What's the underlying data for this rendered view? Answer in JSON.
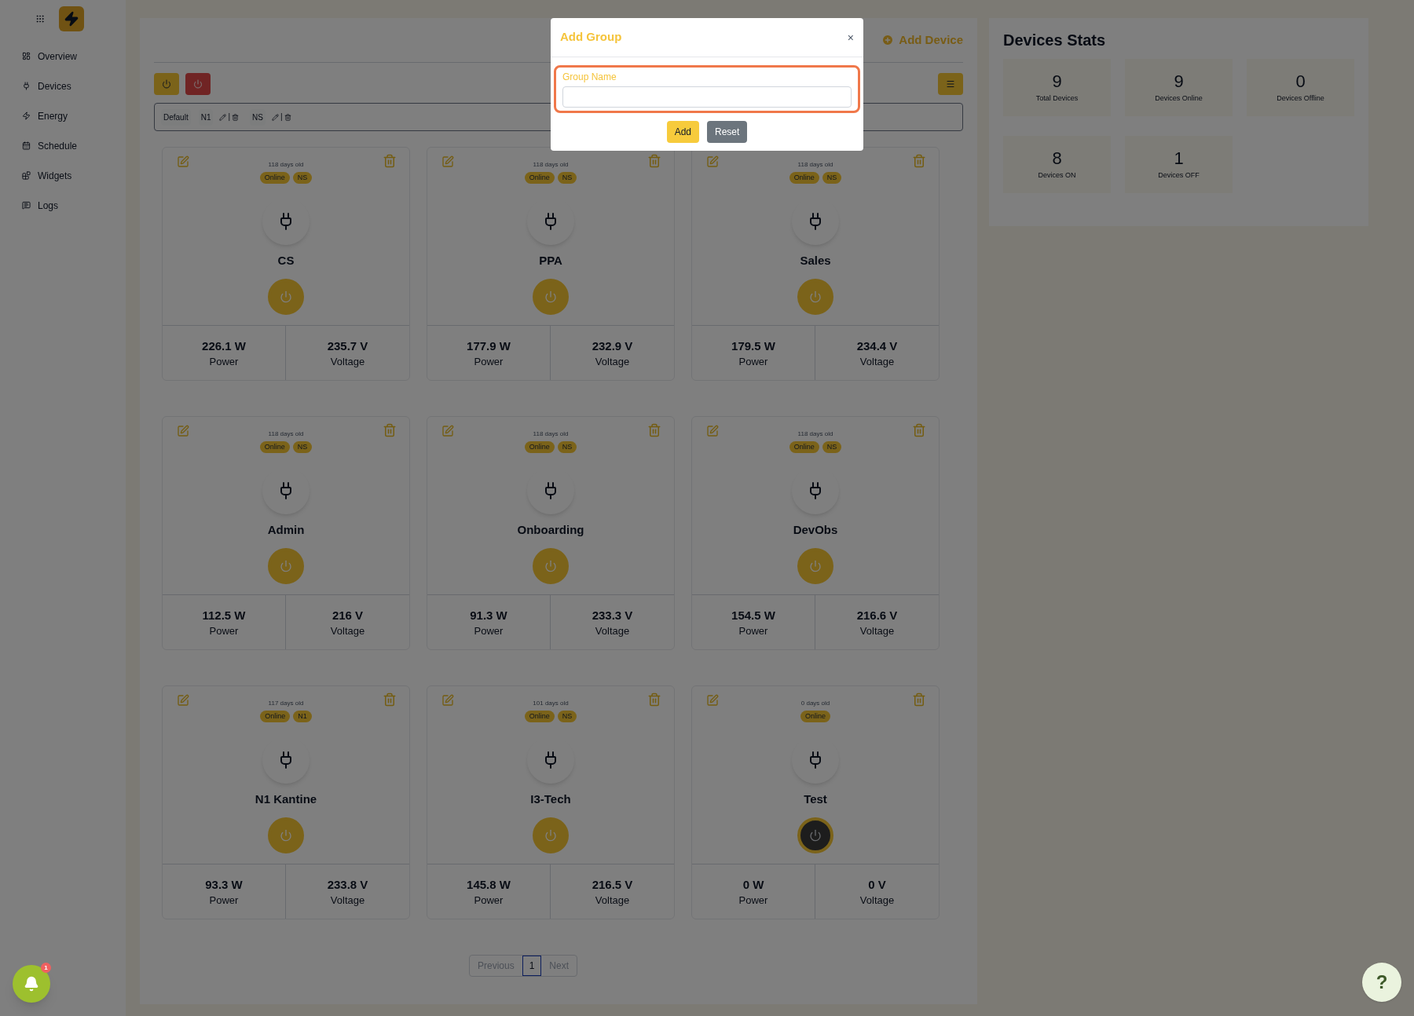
{
  "sidebar": {
    "items": [
      {
        "label": "Overview"
      },
      {
        "label": "Devices"
      },
      {
        "label": "Energy"
      },
      {
        "label": "Schedule"
      },
      {
        "label": "Widgets"
      },
      {
        "label": "Logs"
      }
    ]
  },
  "header": {
    "add_device": "Add Device"
  },
  "groups": [
    {
      "label": "Default",
      "editable": false
    },
    {
      "label": "N1",
      "editable": true,
      "separator": "|"
    },
    {
      "label": "NS",
      "editable": true,
      "separator": "|"
    }
  ],
  "devices": [
    {
      "age": "118 days old",
      "tags": [
        "Online",
        "NS"
      ],
      "name": "CS",
      "on": true,
      "power": "226.1 W",
      "power_label": "Power",
      "voltage": "235.7 V",
      "voltage_label": "Voltage"
    },
    {
      "age": "118 days old",
      "tags": [
        "Online",
        "NS"
      ],
      "name": "PPA",
      "on": true,
      "power": "177.9 W",
      "power_label": "Power",
      "voltage": "232.9 V",
      "voltage_label": "Voltage"
    },
    {
      "age": "118 days old",
      "tags": [
        "Online",
        "NS"
      ],
      "name": "Sales",
      "on": true,
      "power": "179.5 W",
      "power_label": "Power",
      "voltage": "234.4 V",
      "voltage_label": "Voltage"
    },
    {
      "age": "118 days old",
      "tags": [
        "Online",
        "NS"
      ],
      "name": "Admin",
      "on": true,
      "power": "112.5 W",
      "power_label": "Power",
      "voltage": "216 V",
      "voltage_label": "Voltage"
    },
    {
      "age": "118 days old",
      "tags": [
        "Online",
        "NS"
      ],
      "name": "Onboarding",
      "on": true,
      "power": "91.3 W",
      "power_label": "Power",
      "voltage": "233.3 V",
      "voltage_label": "Voltage"
    },
    {
      "age": "118 days old",
      "tags": [
        "Online",
        "NS"
      ],
      "name": "DevObs",
      "on": true,
      "power": "154.5 W",
      "power_label": "Power",
      "voltage": "216.6 V",
      "voltage_label": "Voltage"
    },
    {
      "age": "117 days old",
      "tags": [
        "Online",
        "N1"
      ],
      "name": "N1 Kantine",
      "on": true,
      "power": "93.3 W",
      "power_label": "Power",
      "voltage": "233.8 V",
      "voltage_label": "Voltage"
    },
    {
      "age": "101 days old",
      "tags": [
        "Online",
        "NS"
      ],
      "name": "I3-Tech",
      "on": true,
      "power": "145.8 W",
      "power_label": "Power",
      "voltage": "216.5 V",
      "voltage_label": "Voltage"
    },
    {
      "age": "0 days old",
      "tags": [
        "Online"
      ],
      "name": "Test",
      "on": false,
      "power": "0 W",
      "power_label": "Power",
      "voltage": "0 V",
      "voltage_label": "Voltage"
    }
  ],
  "pagination": {
    "previous": "Previous",
    "pages": [
      {
        "label": "1",
        "selected": true
      }
    ],
    "next": "Next"
  },
  "stats": {
    "title": "Devices Stats",
    "items": [
      {
        "value": "9",
        "label": "Total Devices"
      },
      {
        "value": "9",
        "label": "Devices Online"
      },
      {
        "value": "0",
        "label": "Devices Offline"
      },
      {
        "value": "8",
        "label": "Devices ON"
      },
      {
        "value": "1",
        "label": "Devices OFF"
      }
    ]
  },
  "notifications": {
    "count": "1"
  },
  "help": {
    "label": "?"
  },
  "modal": {
    "title": "Add Group",
    "close": "×",
    "field": {
      "label": "Group Name",
      "focused": true
    },
    "buttons": [
      {
        "label": "Add",
        "kind": "primary"
      },
      {
        "label": "Reset",
        "kind": "secondary"
      }
    ]
  }
}
